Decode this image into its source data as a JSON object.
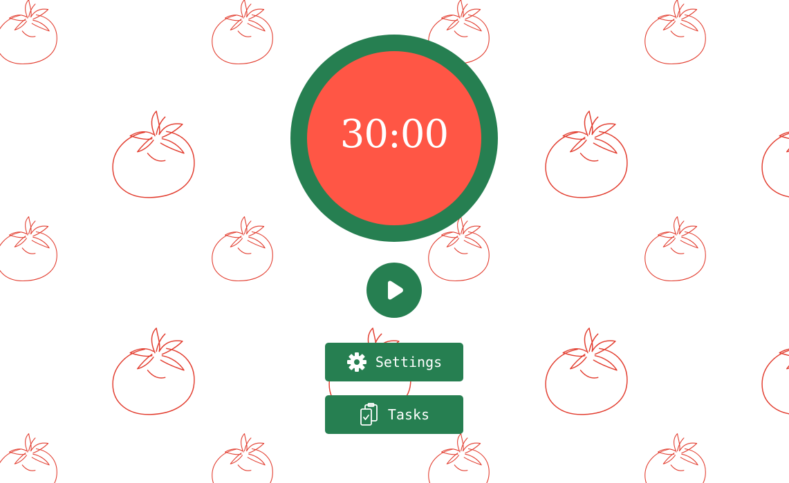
{
  "timer": {
    "display": "30:00"
  },
  "controls": {
    "play_icon": "play-icon",
    "settings_label": "Settings",
    "settings_icon": "gear-icon",
    "tasks_label": "Tasks",
    "tasks_icon": "clipboard-check-icon"
  },
  "theme": {
    "green": "#267f51",
    "tomato": "#ff5645",
    "pattern_stroke": "#e23c2e",
    "background": "#ffffff"
  },
  "background": {
    "pattern_icon": "tomato-outline-icon"
  }
}
